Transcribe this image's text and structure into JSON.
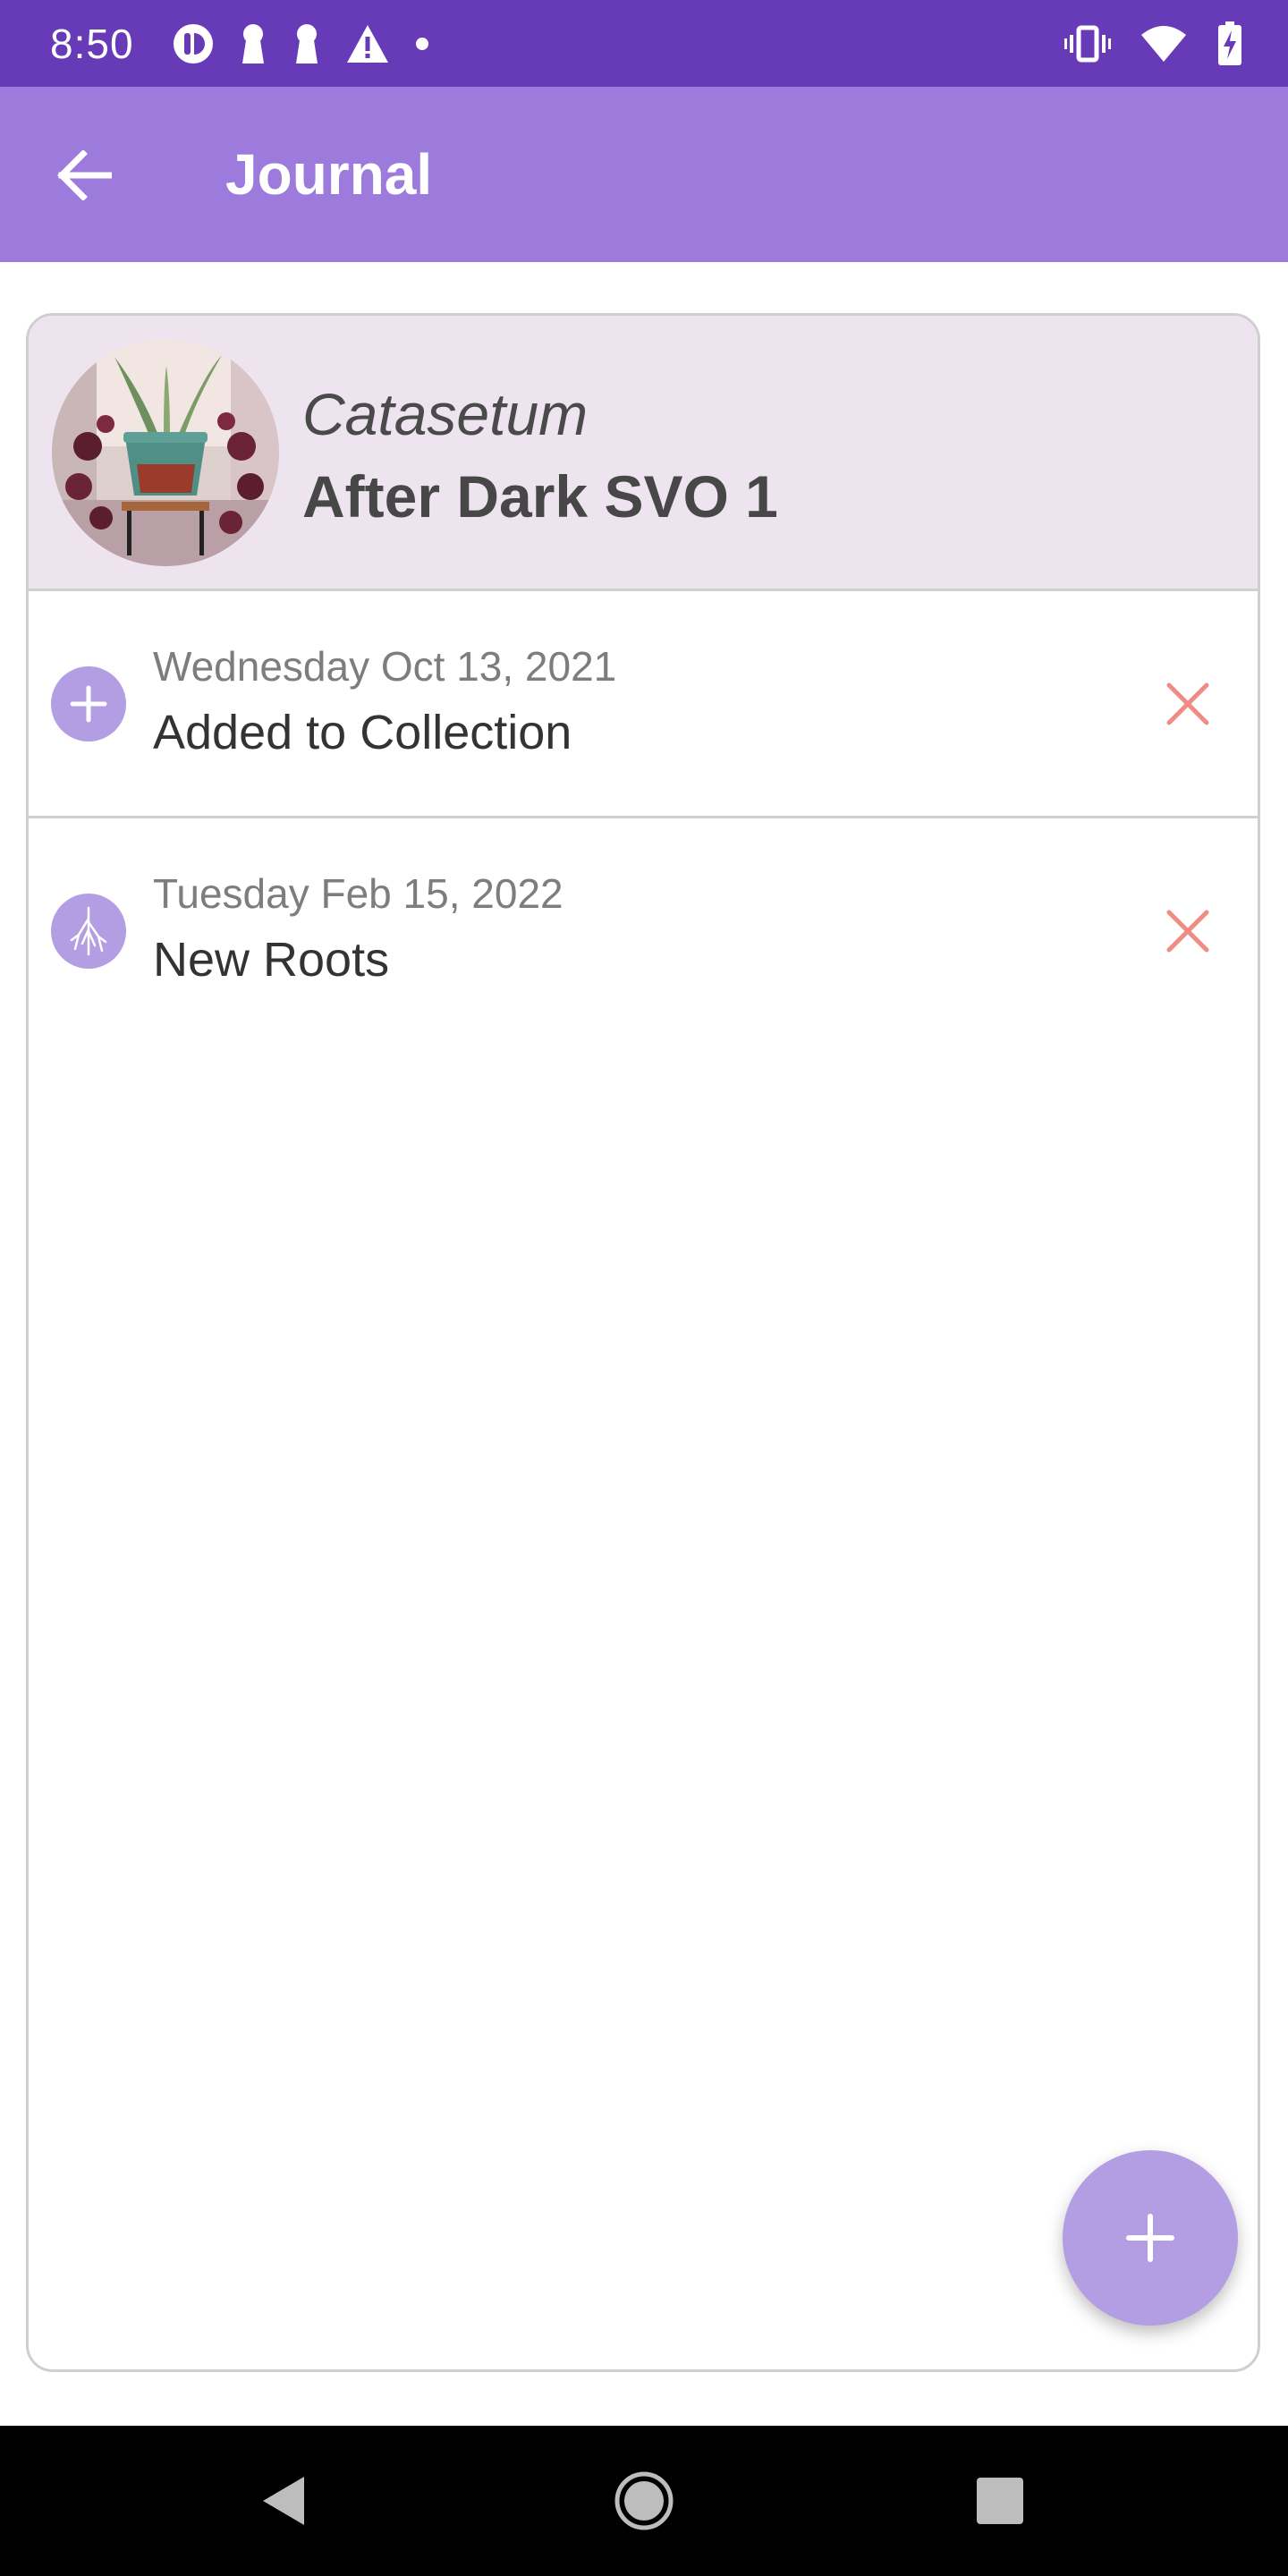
{
  "status_bar": {
    "time": "8:50",
    "left_icons": [
      "data-saver-icon",
      "keyhole-icon",
      "keyhole-icon",
      "warning-icon",
      "dot-icon"
    ],
    "right_icons": [
      "vibrate-icon",
      "wifi-icon",
      "battery-charging-icon"
    ]
  },
  "app_bar": {
    "title": "Journal",
    "back_icon": "arrow-back-icon"
  },
  "plant": {
    "genus": "Catasetum",
    "name": "After Dark SVO 1"
  },
  "entries": [
    {
      "date": "Wednesday Oct 13, 2021",
      "title": "Added to Collection",
      "icon": "plus-icon"
    },
    {
      "date": "Tuesday Feb 15, 2022",
      "title": "New Roots",
      "icon": "roots-icon"
    }
  ],
  "fab": {
    "icon": "plus-icon"
  },
  "colors": {
    "status_bar": "#673AB7",
    "app_bar": "#9C7BDC",
    "header_bg": "#EEE4F0",
    "accent": "#B39DE3",
    "delete": "#F08C86"
  },
  "nav_bar": {
    "buttons": [
      "back-triangle-icon",
      "home-circle-icon",
      "recents-square-icon"
    ]
  }
}
